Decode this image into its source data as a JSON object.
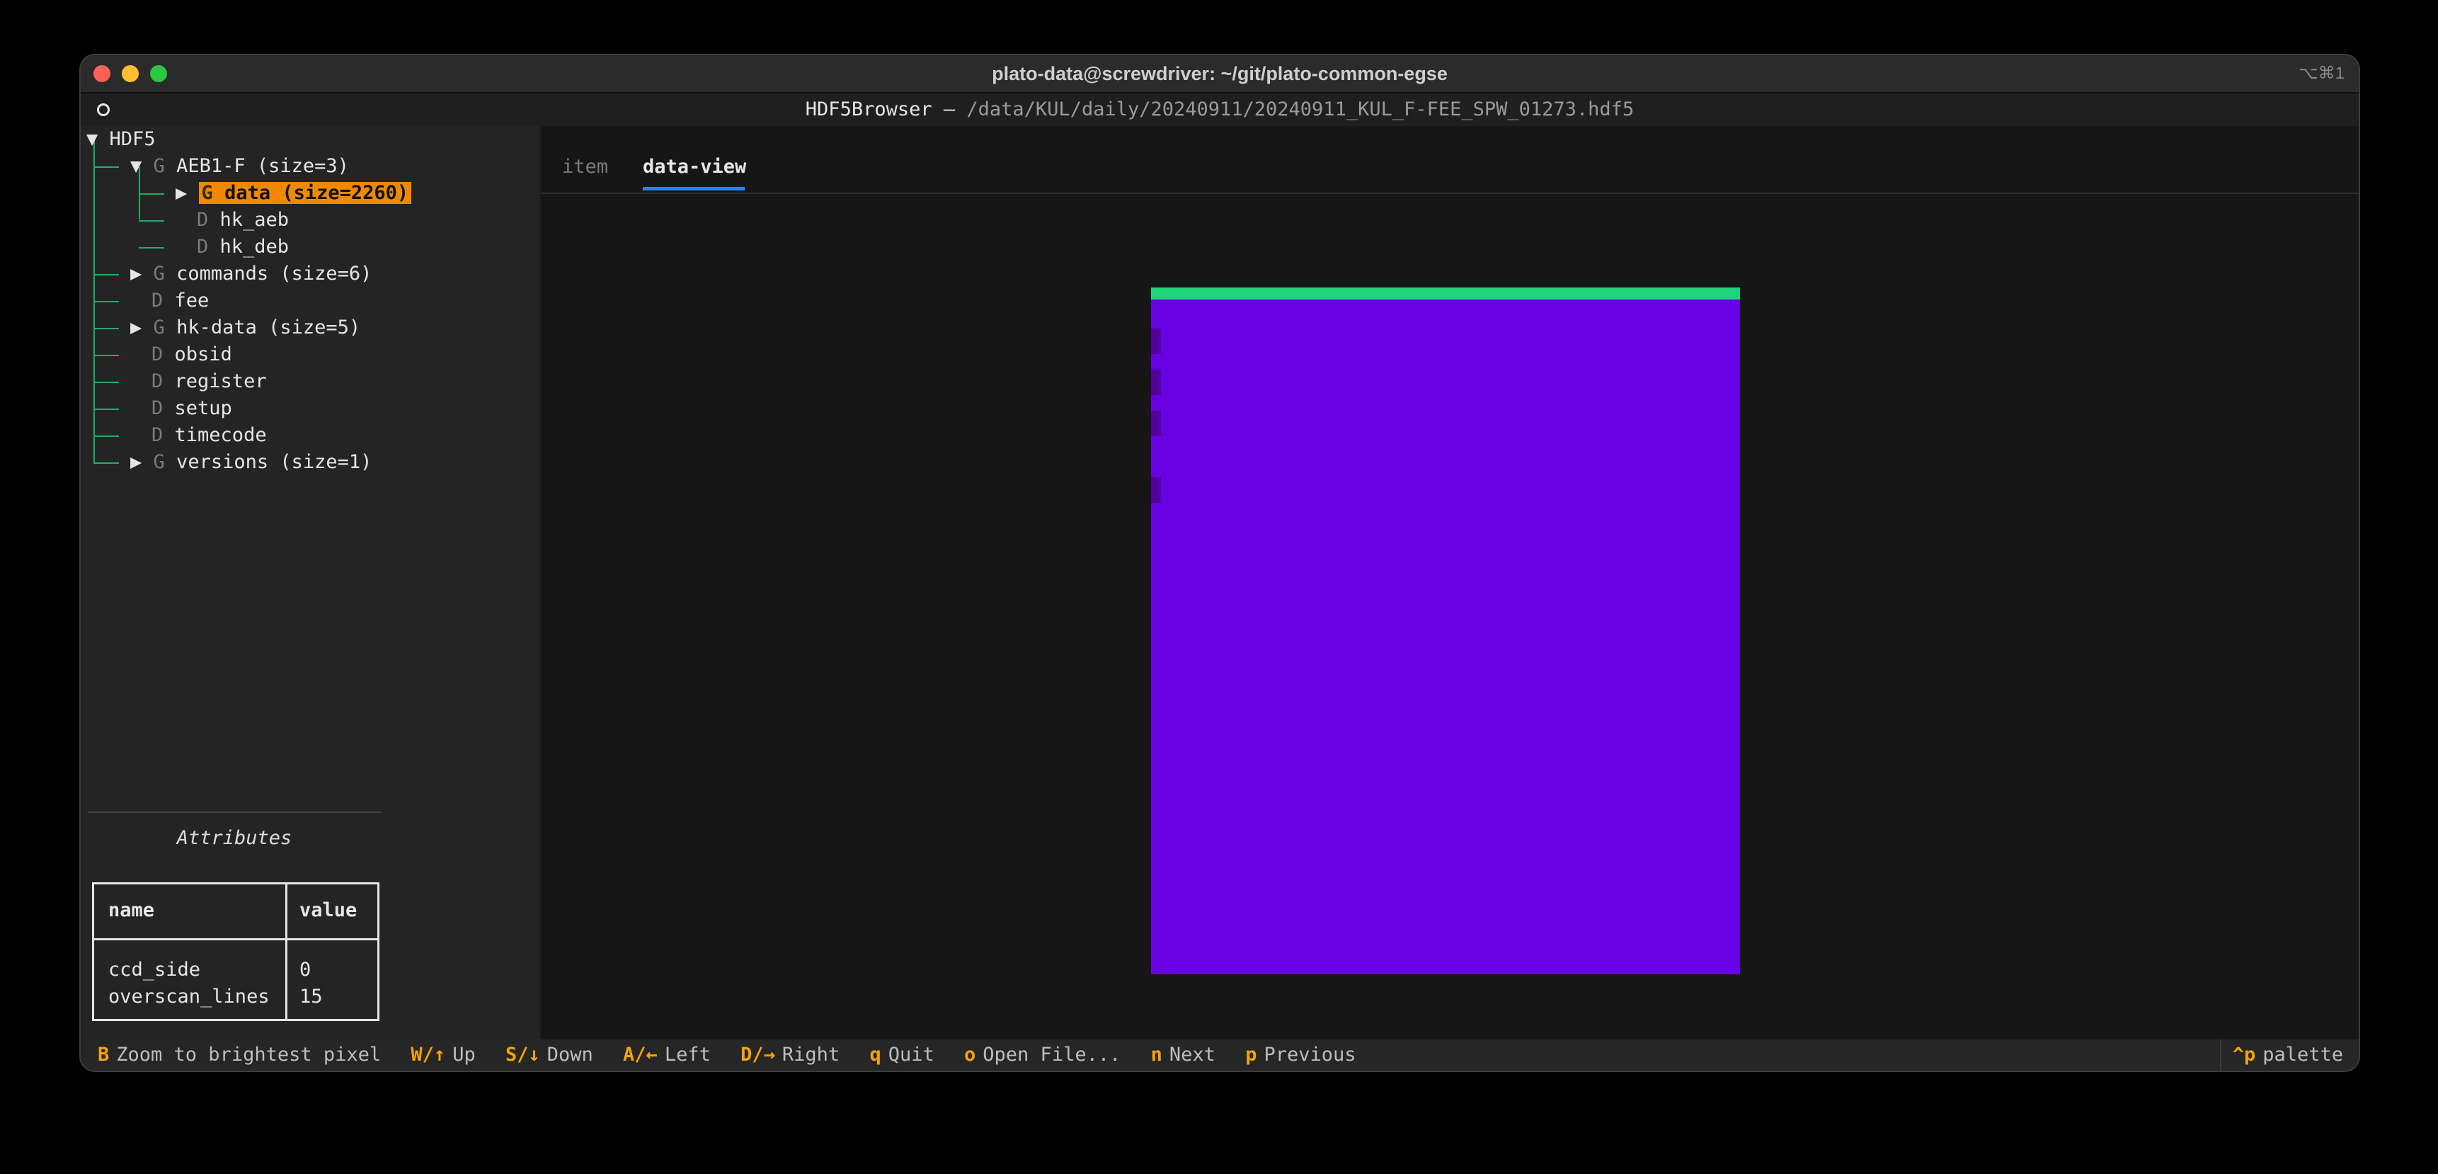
{
  "window": {
    "title": "plato-data@screwdriver: ~/git/plato-common-egse",
    "shortcut": "⌥⌘1"
  },
  "app": {
    "name": "HDF5Browser —",
    "path": "/data/KUL/daily/20240911/20240911_KUL_F-FEE_SPW_01273.hdf5"
  },
  "tree": {
    "root": {
      "arrow": "▼",
      "label": "HDF5"
    },
    "aeb": {
      "arrow": "▼",
      "kind": "G",
      "label": "AEB1-F (size=3)"
    },
    "data": {
      "arrow": "▶",
      "kind": "G",
      "label": "data (size=2260)"
    },
    "hk_aeb": {
      "kind": "D",
      "label": "hk_aeb"
    },
    "hk_deb": {
      "kind": "D",
      "label": "hk_deb"
    },
    "commands": {
      "arrow": "▶",
      "kind": "G",
      "label": "commands (size=6)"
    },
    "fee": {
      "kind": "D",
      "label": "fee"
    },
    "hkdata": {
      "arrow": "▶",
      "kind": "G",
      "label": "hk-data (size=5)"
    },
    "obsid": {
      "kind": "D",
      "label": "obsid"
    },
    "register": {
      "kind": "D",
      "label": "register"
    },
    "setup": {
      "kind": "D",
      "label": "setup"
    },
    "timecode": {
      "kind": "D",
      "label": "timecode"
    },
    "versions": {
      "arrow": "▶",
      "kind": "G",
      "label": "versions (size=1)"
    }
  },
  "attributes": {
    "title": "Attributes",
    "headers": {
      "name": "name",
      "value": "value"
    },
    "rows": [
      {
        "name": "ccd_side",
        "value": "0"
      },
      {
        "name": "overscan_lines",
        "value": "15"
      }
    ]
  },
  "tabs": {
    "item": "item",
    "data_view": "data-view",
    "active": "data-view"
  },
  "image_view": {
    "background": "#6700e3",
    "top_row": "#1ed47a",
    "hot_pixels": "#54009a"
  },
  "statusbar": {
    "items": [
      {
        "key": "B",
        "label": "Zoom to brightest pixel"
      },
      {
        "key": "W/↑",
        "label": "Up"
      },
      {
        "key": "S/↓",
        "label": "Down"
      },
      {
        "key": "A/←",
        "label": "Left"
      },
      {
        "key": "D/→",
        "label": "Right"
      },
      {
        "key": "q",
        "label": "Quit"
      },
      {
        "key": "o",
        "label": "Open File..."
      },
      {
        "key": "n",
        "label": "Next"
      },
      {
        "key": "p",
        "label": "Previous"
      }
    ],
    "palette_key": "^p",
    "palette_label": "palette"
  },
  "colors": {
    "accent": "#ef8a00",
    "tree_guides": "#1fae6a",
    "tab_underline": "#1e88ff",
    "key": "#f3a40b"
  }
}
